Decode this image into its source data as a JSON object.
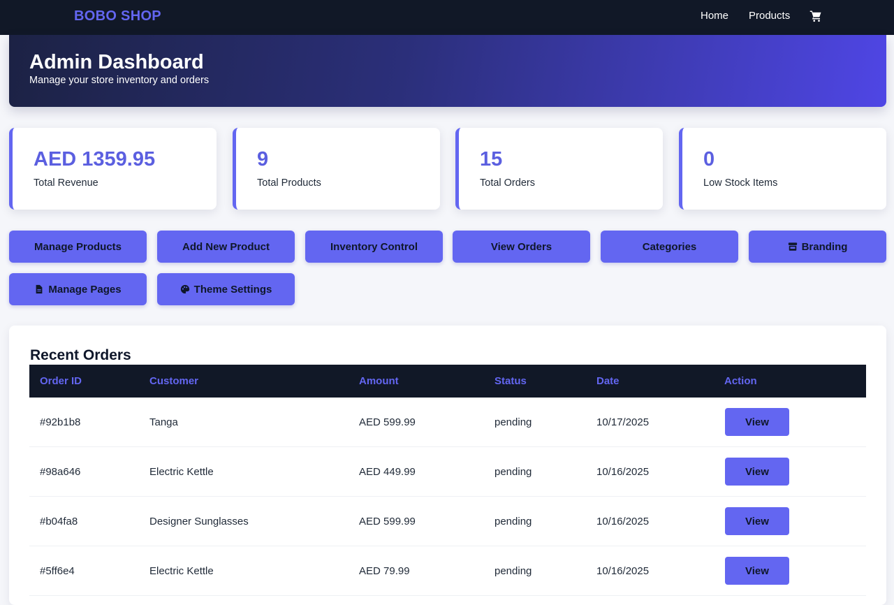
{
  "navbar": {
    "brand": "BOBO SHOP",
    "links": [
      "Home",
      "Products"
    ],
    "cart_icon": "cart-icon"
  },
  "hero": {
    "title": "Admin Dashboard",
    "subtitle": "Manage your store inventory and orders"
  },
  "stats": [
    {
      "value": "AED 1359.95",
      "label": "Total Revenue"
    },
    {
      "value": "9",
      "label": "Total Products"
    },
    {
      "value": "15",
      "label": "Total Orders"
    },
    {
      "value": "0",
      "label": "Low Stock Items"
    }
  ],
  "actions": [
    {
      "label": "Manage Products",
      "icon": ""
    },
    {
      "label": "Add New Product",
      "icon": ""
    },
    {
      "label": "Inventory Control",
      "icon": ""
    },
    {
      "label": "View Orders",
      "icon": ""
    },
    {
      "label": "Categories",
      "icon": ""
    },
    {
      "label": "Branding",
      "icon": "store-icon"
    },
    {
      "label": "Manage Pages",
      "icon": "file-icon"
    },
    {
      "label": "Theme Settings",
      "icon": "palette-icon"
    }
  ],
  "orders": {
    "title": "Recent Orders",
    "columns": [
      "Order ID",
      "Customer",
      "Amount",
      "Status",
      "Date",
      "Action"
    ],
    "rows": [
      {
        "id": "#92b1b8",
        "customer": "Tanga",
        "amount": "AED 599.99",
        "status": "pending",
        "date": "10/17/2025",
        "action": "View"
      },
      {
        "id": "#98a646",
        "customer": "Electric Kettle",
        "amount": "AED 449.99",
        "status": "pending",
        "date": "10/16/2025",
        "action": "View"
      },
      {
        "id": "#b04fa8",
        "customer": "Designer Sunglasses",
        "amount": "AED 599.99",
        "status": "pending",
        "date": "10/16/2025",
        "action": "View"
      },
      {
        "id": "#5ff6e4",
        "customer": "Electric Kettle",
        "amount": "AED 79.99",
        "status": "pending",
        "date": "10/16/2025",
        "action": "View"
      }
    ]
  },
  "colors": {
    "accent": "#6366f1",
    "nav_bg": "#111827",
    "page_bg": "#f5f6fa"
  }
}
